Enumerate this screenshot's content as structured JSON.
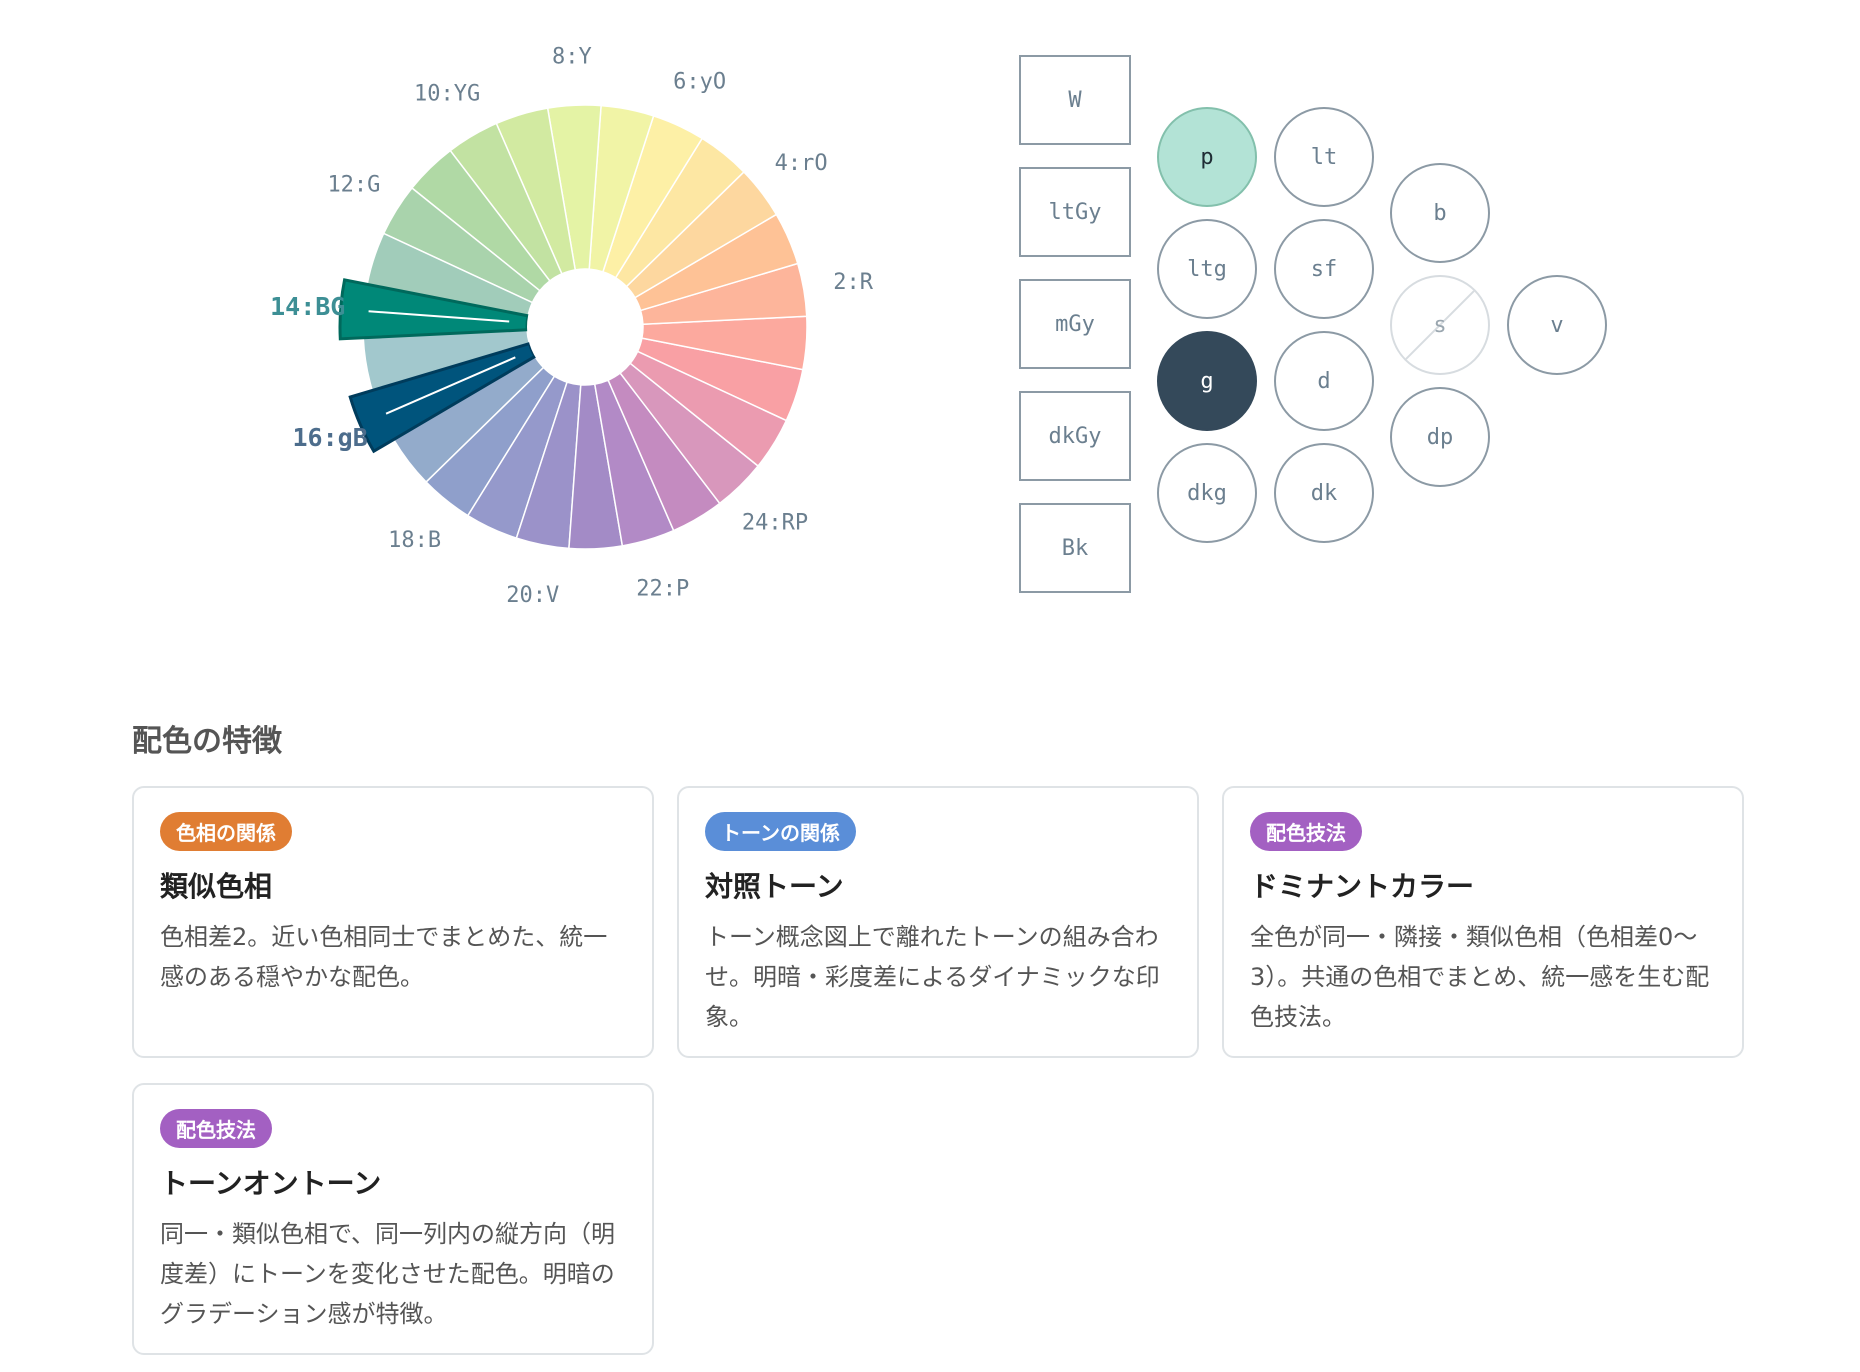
{
  "hue_wheel": {
    "labels": [
      "2:R",
      "4:rO",
      "6:yO",
      "8:Y",
      "10:YG",
      "12:G",
      "14:BG",
      "16:gB",
      "18:B",
      "20:V",
      "22:P",
      "24:RP"
    ],
    "highlighted": [
      "14:BG",
      "16:gB"
    ],
    "segment_colors": [
      "#f9a0a4",
      "#fca99e",
      "#fdb59b",
      "#fec296",
      "#fdd79f",
      "#fde7a3",
      "#fdf0a6",
      "#f1f4a6",
      "#e4f3a5",
      "#d2eaa1",
      "#c2e2a2",
      "#b0d9a5",
      "#a9d3ac",
      "#a1ccba",
      "#008878",
      "#a2c8cd",
      "#00547c",
      "#93abcb",
      "#8f9fcb",
      "#9599cb",
      "#9b92c9",
      "#a38bc6",
      "#b28ac6",
      "#c48bc0",
      "#d897bc",
      "#eb9bb0"
    ]
  },
  "tones": {
    "achromatic": [
      "W",
      "ltGy",
      "mGy",
      "dkGy",
      "Bk"
    ],
    "chromatic": {
      "p": "p",
      "lt": "lt",
      "b": "b",
      "ltg": "ltg",
      "sf": "sf",
      "s": "s",
      "v": "v",
      "g": "g",
      "d": "d",
      "dp": "dp",
      "dkg": "dkg",
      "dk": "dk"
    },
    "highlighted": [
      "p",
      "g"
    ],
    "disabled": [
      "s"
    ]
  },
  "section_title": "配色の特徴",
  "cards": [
    {
      "badge": "色相の関係",
      "badge_color": "#e07d33",
      "title": "類似色相",
      "desc": "色相差2。近い色相同士でまとめた、統一感のある穏やかな配色。"
    },
    {
      "badge": "トーンの関係",
      "badge_color": "#5a8ed8",
      "title": "対照トーン",
      "desc": "トーン概念図上で離れたトーンの組み合わせ。明暗・彩度差によるダイナミックな印象。"
    },
    {
      "badge": "配色技法",
      "badge_color": "#a360c2",
      "title": "ドミナントカラー",
      "desc": "全色が同一・隣接・類似色相（色相差0〜3）。共通の色相でまとめ、統一感を生む配色技法。"
    },
    {
      "badge": "配色技法",
      "badge_color": "#a360c2",
      "title": "トーンオントーン",
      "desc": "同一・類似色相で、同一列内の縦方向（明度差）にトーンを変化させた配色。明暗のグラデーション感が特徴。"
    }
  ]
}
